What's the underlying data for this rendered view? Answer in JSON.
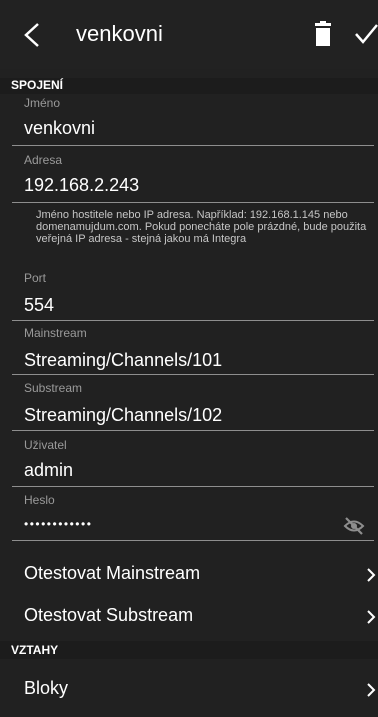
{
  "toolbar": {
    "title": "venkovni"
  },
  "sections": {
    "connection": "SPOJENÍ",
    "relations": "VZTAHY"
  },
  "fields": {
    "name": {
      "label": "Jméno",
      "value": "venkovni"
    },
    "address": {
      "label": "Adresa",
      "value": "192.168.2.243",
      "hint": "Jméno hostitele nebo IP adresa. Například: 192.168.1.145 nebo domenamujdum.com. Pokud ponecháte pole prázdné, bude použita veřejná IP adresa - stejná jakou má Integra"
    },
    "port": {
      "label": "Port",
      "value": "554"
    },
    "mainstream": {
      "label": "Mainstream",
      "value": "Streaming/Channels/101"
    },
    "substream": {
      "label": "Substream",
      "value": "Streaming/Channels/102"
    },
    "user": {
      "label": "Uživatel",
      "value": "admin"
    },
    "password": {
      "label": "Heslo",
      "value": "••••••••••••"
    }
  },
  "actions": {
    "test_mainstream": "Otestovat Mainstream",
    "test_substream": "Otestovat Substream",
    "blocks": "Bloky"
  },
  "icons": {
    "back": "back-arrow-icon",
    "delete": "trash-icon",
    "confirm": "check-icon",
    "password_visibility": "eye-off-icon",
    "chevron": "chevron-right-icon"
  },
  "colors": {
    "background": "#212121",
    "toolbar": "#222222",
    "section_header": "#1c1c1c",
    "label": "#9a9a9a",
    "underline": "#8e8e8e"
  }
}
